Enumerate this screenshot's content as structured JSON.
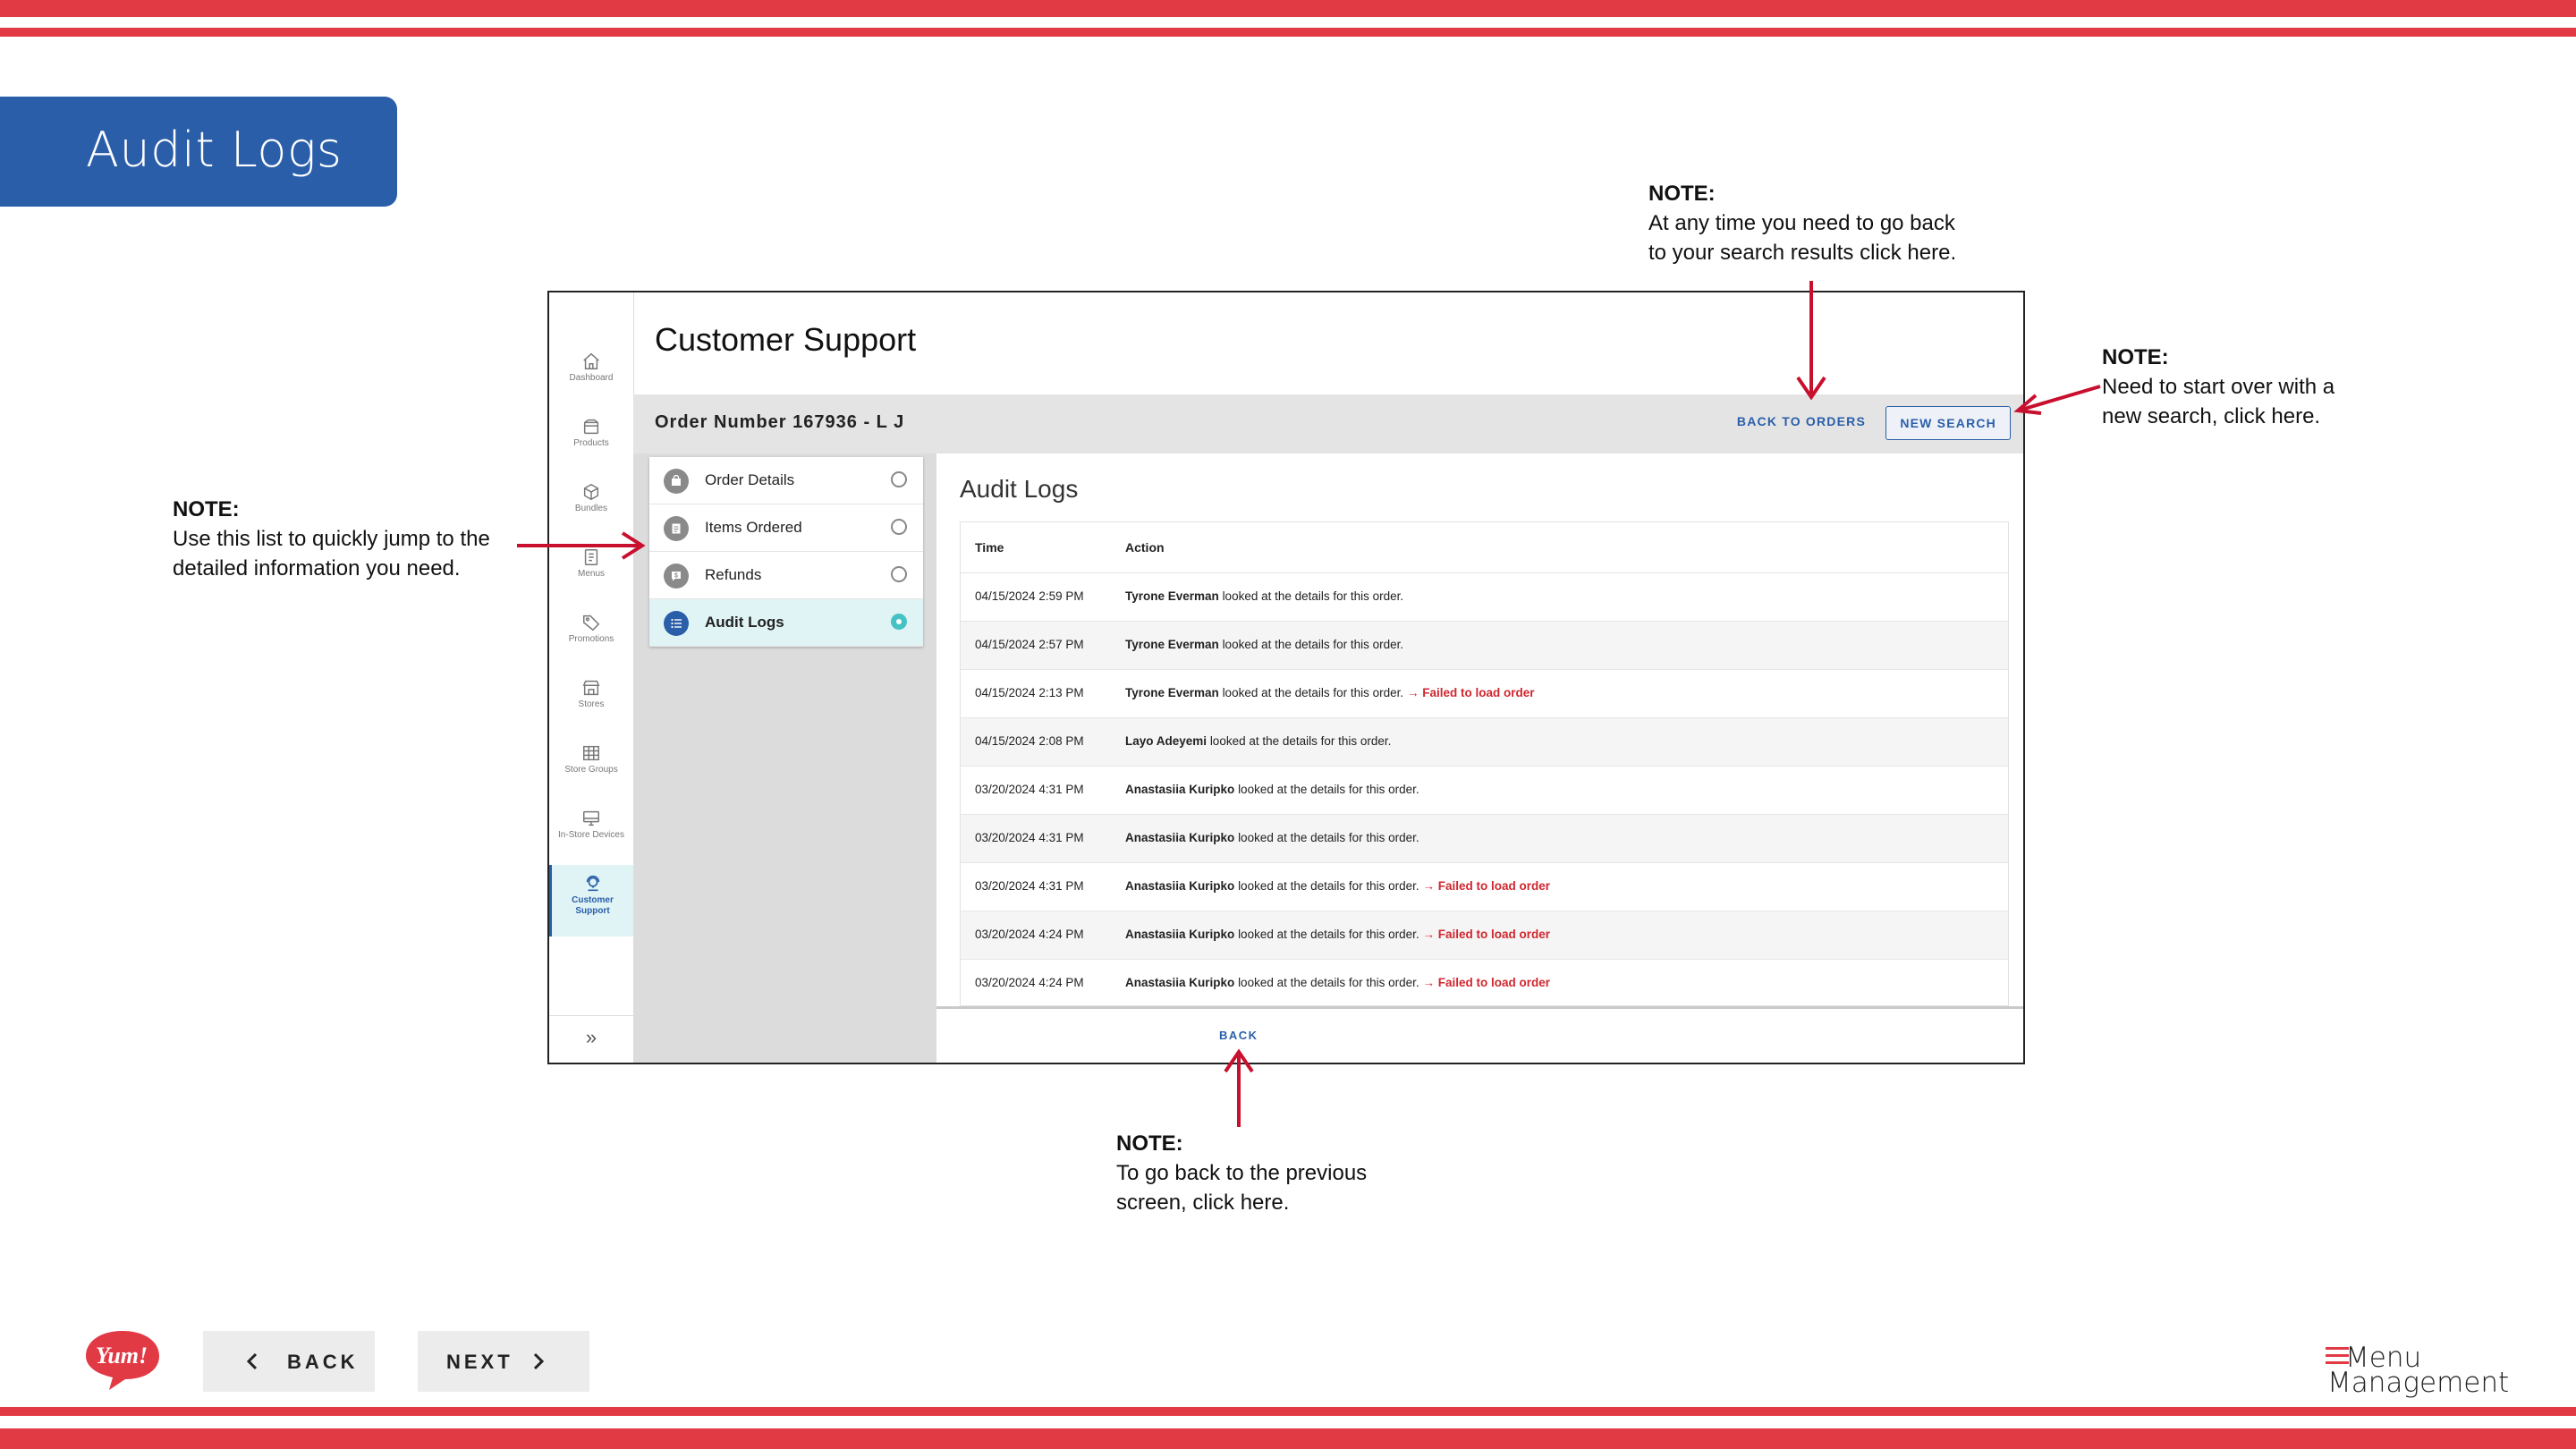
{
  "slide": {
    "title": "Audit Logs"
  },
  "notes": {
    "back_to_orders": {
      "heading": "NOTE:",
      "body": "At any time you need to go back\nto your search results click here."
    },
    "new_search": {
      "heading": "NOTE:",
      "body": "Need to start over with a\nnew search, click here."
    },
    "section_list": {
      "heading": "NOTE:",
      "body": "Use this list to quickly jump to the\ndetailed information you need."
    },
    "back": {
      "heading": "NOTE:",
      "body": "To go back to the previous\nscreen, click here."
    }
  },
  "app": {
    "sidebar": {
      "items": [
        {
          "label": "Dashboard",
          "icon": "home-icon"
        },
        {
          "label": "Products",
          "icon": "box-icon"
        },
        {
          "label": "Bundles",
          "icon": "cube-icon"
        },
        {
          "label": "Menus",
          "icon": "menu-book-icon"
        },
        {
          "label": "Promotions",
          "icon": "tag-icon"
        },
        {
          "label": "Stores",
          "icon": "store-icon"
        },
        {
          "label": "Store Groups",
          "icon": "grid-icon"
        },
        {
          "label": "In-Store Devices",
          "icon": "monitor-icon"
        },
        {
          "label": "Customer Support",
          "icon": "support-agent-icon",
          "active": true
        }
      ],
      "collapse": "»"
    },
    "page_title": "Customer Support",
    "order": {
      "number": "Order Number 167936 - L J",
      "back_to_orders": "BACK TO ORDERS",
      "new_search": "NEW SEARCH"
    },
    "sections": [
      {
        "label": "Order Details",
        "icon": "bag-icon",
        "selected": false
      },
      {
        "label": "Items Ordered",
        "icon": "receipt-icon",
        "selected": false
      },
      {
        "label": "Refunds",
        "icon": "refund-icon",
        "selected": false
      },
      {
        "label": "Audit Logs",
        "icon": "list-icon",
        "selected": true
      }
    ],
    "audit": {
      "title": "Audit Logs",
      "columns": {
        "time": "Time",
        "action": "Action"
      },
      "rows": [
        {
          "time": "04/15/2024 2:59 PM",
          "user": "Tyrone Everman",
          "action": "looked at the details for this order.",
          "error": ""
        },
        {
          "time": "04/15/2024 2:57 PM",
          "user": "Tyrone Everman",
          "action": "looked at the details for this order.",
          "error": ""
        },
        {
          "time": "04/15/2024 2:13 PM",
          "user": "Tyrone Everman",
          "action": "looked at the details for this order.",
          "error": "Failed to load order"
        },
        {
          "time": "04/15/2024 2:08 PM",
          "user": "Layo Adeyemi",
          "action": "looked at the details for this order.",
          "error": ""
        },
        {
          "time": "03/20/2024 4:31 PM",
          "user": "Anastasiia Kuripko",
          "action": "looked at the details for this order.",
          "error": ""
        },
        {
          "time": "03/20/2024 4:31 PM",
          "user": "Anastasiia Kuripko",
          "action": "looked at the details for this order.",
          "error": ""
        },
        {
          "time": "03/20/2024 4:31 PM",
          "user": "Anastasiia Kuripko",
          "action": "looked at the details for this order.",
          "error": "Failed to load order"
        },
        {
          "time": "03/20/2024 4:24 PM",
          "user": "Anastasiia Kuripko",
          "action": "looked at the details for this order.",
          "error": "Failed to load order"
        },
        {
          "time": "03/20/2024 4:24 PM",
          "user": "Anastasiia Kuripko",
          "action": "looked at the details for this order.",
          "error": "Failed to load order"
        }
      ],
      "arrow_glyph": "→"
    },
    "footer_back": "BACK"
  },
  "controls": {
    "back": "BACK",
    "next": "NEXT"
  },
  "logos": {
    "yum": "Yum!",
    "brand_line1": "Menu",
    "brand_line2": "Management"
  },
  "colors": {
    "accent_red": "#e23a45",
    "brand_blue": "#2a5ea9",
    "teal": "#46c2c5",
    "error_red": "#d0262e"
  }
}
